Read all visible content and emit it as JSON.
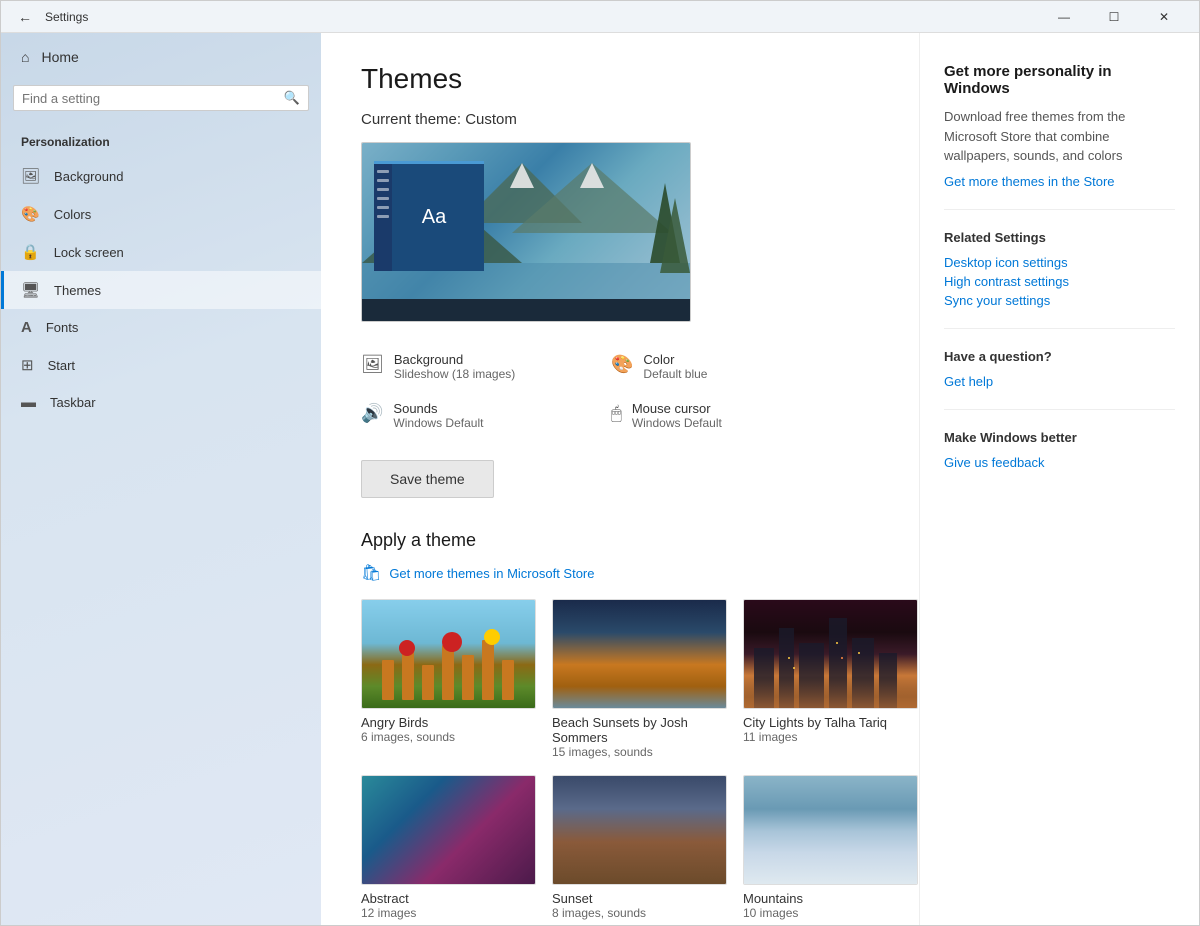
{
  "window": {
    "title": "Settings",
    "controls": {
      "minimize": "—",
      "maximize": "☐",
      "close": "✕"
    }
  },
  "sidebar": {
    "home_label": "Home",
    "search_placeholder": "Find a setting",
    "section_title": "Personalization",
    "items": [
      {
        "id": "background",
        "label": "Background",
        "icon": "🖼"
      },
      {
        "id": "colors",
        "label": "Colors",
        "icon": "🎨"
      },
      {
        "id": "lock-screen",
        "label": "Lock screen",
        "icon": "🔒"
      },
      {
        "id": "themes",
        "label": "Themes",
        "icon": "🖥"
      },
      {
        "id": "fonts",
        "label": "Fonts",
        "icon": "A"
      },
      {
        "id": "start",
        "label": "Start",
        "icon": "⊞"
      },
      {
        "id": "taskbar",
        "label": "Taskbar",
        "icon": "▬"
      }
    ]
  },
  "main": {
    "page_title": "Themes",
    "current_theme_label": "Current theme: Custom",
    "theme_attrs": [
      {
        "id": "background",
        "icon": "🖼",
        "name": "Background",
        "value": "Slideshow (18 images)"
      },
      {
        "id": "color",
        "icon": "🎨",
        "name": "Color",
        "value": "Default blue"
      },
      {
        "id": "sounds",
        "icon": "🔊",
        "name": "Sounds",
        "value": "Windows Default"
      },
      {
        "id": "mouse-cursor",
        "icon": "🖱",
        "name": "Mouse cursor",
        "value": "Windows Default"
      }
    ],
    "save_theme_label": "Save theme",
    "apply_theme_label": "Apply a theme",
    "store_link_label": "Get more themes in Microsoft Store",
    "themes": [
      {
        "id": "angry-birds",
        "name": "Angry Birds",
        "desc": "6 images, sounds",
        "bg": "angry-birds"
      },
      {
        "id": "beach-sunsets",
        "name": "Beach Sunsets by Josh Sommers",
        "desc": "15 images, sounds",
        "bg": "beach"
      },
      {
        "id": "city-lights",
        "name": "City Lights by Talha Tariq",
        "desc": "11 images",
        "bg": "city"
      },
      {
        "id": "abstract",
        "name": "Abstract",
        "desc": "12 images",
        "bg": "abstract"
      },
      {
        "id": "sunset",
        "name": "Sunset",
        "desc": "8 images, sounds",
        "bg": "sunset"
      },
      {
        "id": "mountains",
        "name": "Mountains",
        "desc": "10 images",
        "bg": "mountain"
      }
    ]
  },
  "right_panel": {
    "promo_title": "Get more personality in Windows",
    "promo_desc": "Download free themes from the Microsoft Store that combine wallpapers, sounds, and colors",
    "promo_link": "Get more themes in the Store",
    "related_title": "Related Settings",
    "related_links": [
      "Desktop icon settings",
      "High contrast settings",
      "Sync your settings"
    ],
    "help_title": "Have a question?",
    "help_link": "Get help",
    "feedback_title": "Make Windows better",
    "feedback_link": "Give us feedback"
  }
}
